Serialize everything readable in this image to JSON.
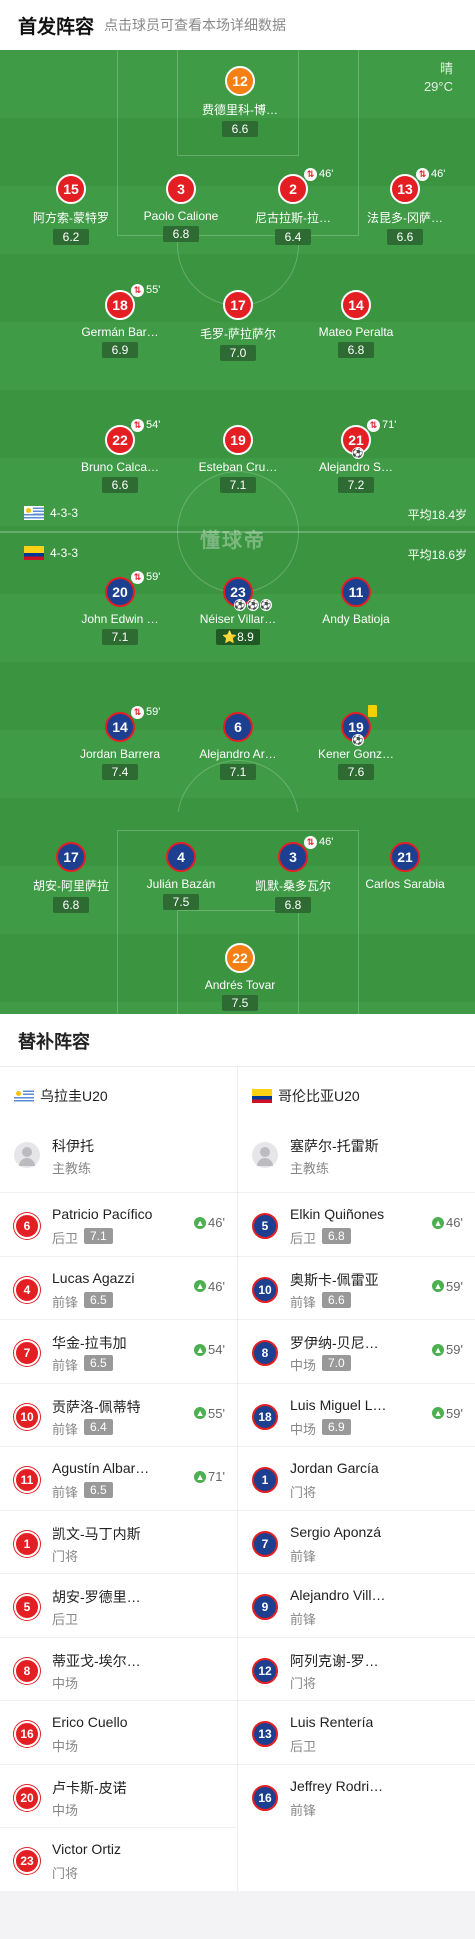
{
  "header": {
    "title": "首发阵容",
    "subtitle": "点击球员可查看本场详细数据"
  },
  "weather": {
    "condition": "晴",
    "temperature": "29°C"
  },
  "field_logo": "懂球帝",
  "home_team": {
    "formation": "4-3-3",
    "avg_age": "平均18.4岁"
  },
  "away_team": {
    "formation": "4-3-3",
    "avg_age": "平均18.6岁"
  },
  "home_players": [
    {
      "num": "12",
      "name": "费德里科-博…",
      "rating": "6.6",
      "gk": true
    },
    {
      "num": "15",
      "name": "阿方索-蒙特罗",
      "rating": "6.2"
    },
    {
      "num": "3",
      "name": "Paolo Calione",
      "rating": "6.8"
    },
    {
      "num": "2",
      "name": "尼古拉斯-拉…",
      "rating": "6.4",
      "sub_time": "46'"
    },
    {
      "num": "13",
      "name": "法昆多-冈萨…",
      "rating": "6.6",
      "sub_time": "46'"
    },
    {
      "num": "18",
      "name": "Germán Bar…",
      "rating": "6.9",
      "sub_time": "55'"
    },
    {
      "num": "17",
      "name": "毛罗-萨拉萨尔",
      "rating": "7.0"
    },
    {
      "num": "14",
      "name": "Mateo Peralta",
      "rating": "6.8"
    },
    {
      "num": "22",
      "name": "Bruno Calca…",
      "rating": "6.6",
      "sub_time": "54'"
    },
    {
      "num": "19",
      "name": "Esteban Cru…",
      "rating": "7.1"
    },
    {
      "num": "21",
      "name": "Alejandro S…",
      "rating": "7.2",
      "sub_time": "71'",
      "goals": 1
    }
  ],
  "away_players": [
    {
      "num": "20",
      "name": "John Edwin …",
      "rating": "7.1",
      "sub_time": "59'"
    },
    {
      "num": "23",
      "name": "Néiser Villar…",
      "rating": "8.9",
      "goals": 3,
      "star": true
    },
    {
      "num": "11",
      "name": "Andy Batioja",
      "rating": ""
    },
    {
      "num": "14",
      "name": "Jordan Barrera",
      "rating": "7.4",
      "sub_time": "59'"
    },
    {
      "num": "6",
      "name": "Alejandro Ar…",
      "rating": "7.1"
    },
    {
      "num": "19",
      "name": "Kener Gonz…",
      "rating": "7.6",
      "goals": 1,
      "yellow": true
    },
    {
      "num": "17",
      "name": "胡安-阿里萨拉",
      "rating": "6.8"
    },
    {
      "num": "4",
      "name": "Julián Bazán",
      "rating": "7.5"
    },
    {
      "num": "3",
      "name": "凯默-桑多瓦尔",
      "rating": "6.8",
      "sub_time": "46'"
    },
    {
      "num": "21",
      "name": "Carlos Sarabia",
      "rating": ""
    },
    {
      "num": "22",
      "name": "Andrés Tovar",
      "rating": "7.5",
      "gk": true
    }
  ],
  "bench": {
    "title": "替补阵容",
    "home": {
      "team_name": "乌拉圭U20",
      "coach": {
        "name": "科伊托",
        "role": "主教练"
      },
      "players": [
        {
          "num": "6",
          "name": "Patricio Pacífico",
          "pos": "后卫",
          "rating": "7.1",
          "in": "46'"
        },
        {
          "num": "4",
          "name": "Lucas Agazzi",
          "pos": "前锋",
          "rating": "6.5",
          "in": "46'"
        },
        {
          "num": "7",
          "name": "华金-拉韦加",
          "pos": "前锋",
          "rating": "6.5",
          "in": "54'"
        },
        {
          "num": "10",
          "name": "贡萨洛-佩蒂特",
          "pos": "前锋",
          "rating": "6.4",
          "in": "55'"
        },
        {
          "num": "11",
          "name": "Agustín Albar…",
          "pos": "前锋",
          "rating": "6.5",
          "in": "71'"
        },
        {
          "num": "1",
          "name": "凯文-马丁内斯",
          "pos": "门将",
          "rating": "",
          "in": ""
        },
        {
          "num": "5",
          "name": "胡安-罗德里…",
          "pos": "后卫",
          "rating": "",
          "in": ""
        },
        {
          "num": "8",
          "name": "蒂亚戈-埃尔…",
          "pos": "中场",
          "rating": "",
          "in": ""
        },
        {
          "num": "16",
          "name": "Erico Cuello",
          "pos": "中场",
          "rating": "",
          "in": ""
        },
        {
          "num": "20",
          "name": "卢卡斯-皮诺",
          "pos": "中场",
          "rating": "",
          "in": ""
        },
        {
          "num": "23",
          "name": "Victor Ortiz",
          "pos": "门将",
          "rating": "",
          "in": ""
        }
      ]
    },
    "away": {
      "team_name": "哥伦比亚U20",
      "coach": {
        "name": "塞萨尔-托雷斯",
        "role": "主教练"
      },
      "players": [
        {
          "num": "5",
          "name": "Elkin Quiñones",
          "pos": "后卫",
          "rating": "6.8",
          "in": "46'"
        },
        {
          "num": "10",
          "name": "奥斯卡-佩雷亚",
          "pos": "前锋",
          "rating": "6.6",
          "in": "59'"
        },
        {
          "num": "8",
          "name": "罗伊纳-贝尼…",
          "pos": "中场",
          "rating": "7.0",
          "in": "59'"
        },
        {
          "num": "18",
          "name": "Luis Miguel L…",
          "pos": "中场",
          "rating": "6.9",
          "in": "59'"
        },
        {
          "num": "1",
          "name": "Jordan García",
          "pos": "门将",
          "rating": "",
          "in": ""
        },
        {
          "num": "7",
          "name": "Sergio Aponzá",
          "pos": "前锋",
          "rating": "",
          "in": ""
        },
        {
          "num": "9",
          "name": "Alejandro Vill…",
          "pos": "前锋",
          "rating": "",
          "in": ""
        },
        {
          "num": "12",
          "name": "阿列克谢-罗…",
          "pos": "门将",
          "rating": "",
          "in": ""
        },
        {
          "num": "13",
          "name": "Luis Rentería",
          "pos": "后卫",
          "rating": "",
          "in": ""
        },
        {
          "num": "16",
          "name": "Jeffrey Rodri…",
          "pos": "前锋",
          "rating": "",
          "in": ""
        }
      ]
    }
  },
  "colors": {
    "home": "#e31f24",
    "away": "#1c3f8f",
    "gk": "#f47f12",
    "pitch": "#3f9b45"
  }
}
